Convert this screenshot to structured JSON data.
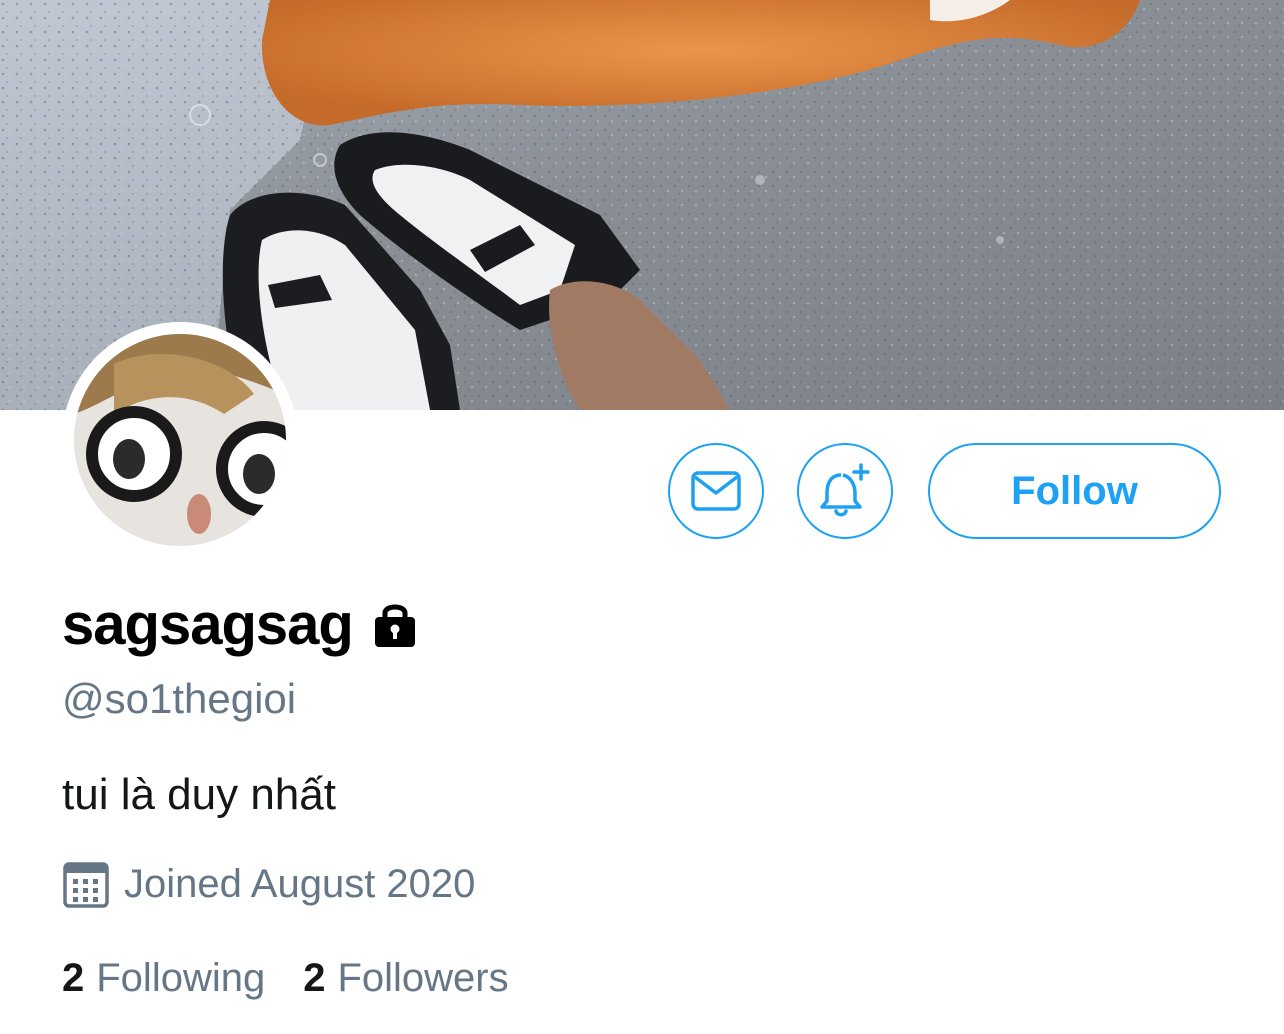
{
  "profile": {
    "display_name": "sagsagsag",
    "handle": "@so1thegioi",
    "bio": "tui là duy nhất",
    "joined": "Joined August 2020",
    "protected": true
  },
  "actions": {
    "message_icon": "envelope-icon",
    "notify_icon": "bell-plus-icon",
    "follow_label": "Follow"
  },
  "stats": {
    "following_count": "2",
    "following_label": "Following",
    "followers_count": "2",
    "followers_label": "Followers"
  },
  "colors": {
    "accent": "#1da1f2",
    "secondary_text": "#657786",
    "primary_text": "#14171a"
  }
}
